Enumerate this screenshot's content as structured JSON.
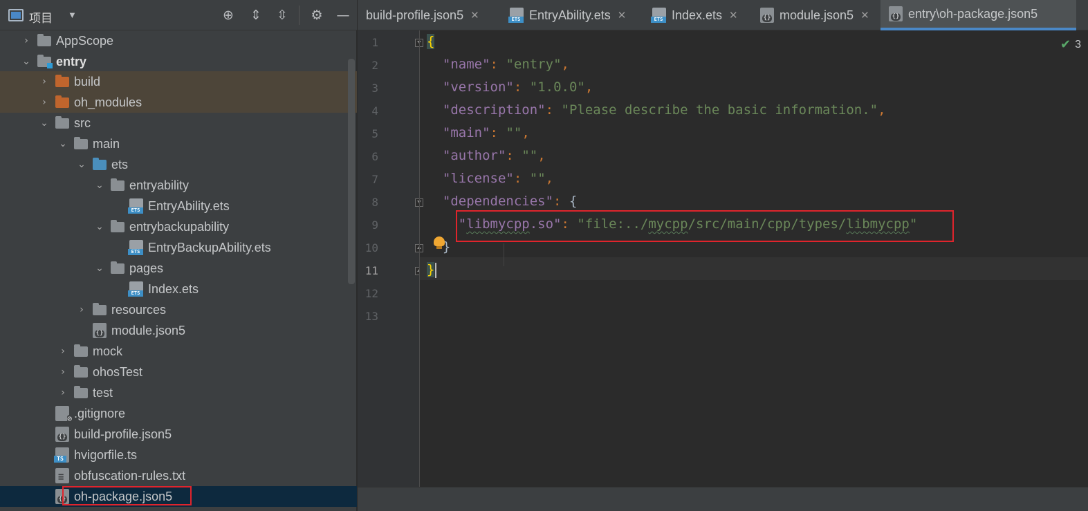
{
  "project_panel": {
    "title": "项目",
    "toolbar": {
      "dropdown_icon": "chevron-down-icon",
      "locate_icon": "crosshair-icon",
      "expand_all_icon": "expand-all-icon",
      "collapse_all_icon": "collapse-all-icon",
      "settings_icon": "gear-icon",
      "hide_icon": "minimize-icon"
    },
    "tree": [
      {
        "label": "AppScope",
        "type": "folder",
        "expanded": false
      },
      {
        "label": "entry",
        "type": "module-folder",
        "expanded": true
      },
      {
        "label": "build",
        "type": "folder-orange",
        "expanded": false
      },
      {
        "label": "oh_modules",
        "type": "folder-orange",
        "expanded": false
      },
      {
        "label": "src",
        "type": "folder",
        "expanded": true
      },
      {
        "label": "main",
        "type": "folder",
        "expanded": true
      },
      {
        "label": "ets",
        "type": "folder-blue",
        "expanded": true
      },
      {
        "label": "entryability",
        "type": "folder",
        "expanded": true
      },
      {
        "label": "EntryAbility.ets",
        "type": "ets-file"
      },
      {
        "label": "entrybackupability",
        "type": "folder",
        "expanded": true
      },
      {
        "label": "EntryBackupAbility.ets",
        "type": "ets-file"
      },
      {
        "label": "pages",
        "type": "folder",
        "expanded": true
      },
      {
        "label": "Index.ets",
        "type": "ets-file"
      },
      {
        "label": "resources",
        "type": "folder",
        "expanded": false
      },
      {
        "label": "module.json5",
        "type": "json-file"
      },
      {
        "label": "mock",
        "type": "folder",
        "expanded": false
      },
      {
        "label": "ohosTest",
        "type": "folder",
        "expanded": false
      },
      {
        "label": "test",
        "type": "folder",
        "expanded": false
      },
      {
        "label": ".gitignore",
        "type": "git-file"
      },
      {
        "label": "build-profile.json5",
        "type": "json-file"
      },
      {
        "label": "hvigorfile.ts",
        "type": "ts-file"
      },
      {
        "label": "obfuscation-rules.txt",
        "type": "txt-file"
      },
      {
        "label": "oh-package.json5",
        "type": "json-file",
        "selected": true
      }
    ]
  },
  "editor": {
    "tabs": [
      {
        "label": "build-profile.json5",
        "icon": "none",
        "active": false
      },
      {
        "label": "EntryAbility.ets",
        "icon": "ets-file-icon",
        "active": false
      },
      {
        "label": "Index.ets",
        "icon": "ets-file-icon",
        "active": false
      },
      {
        "label": "module.json5",
        "icon": "json-file-icon",
        "active": false
      },
      {
        "label": "entry\\oh-package.json5",
        "icon": "json-file-icon",
        "active": true
      }
    ],
    "close_glyph": "✕",
    "inspection_count": "3",
    "line_numbers": [
      "1",
      "2",
      "3",
      "4",
      "5",
      "6",
      "7",
      "8",
      "9",
      "10",
      "11",
      "12",
      "13"
    ],
    "code": {
      "l1_open": "{",
      "l2_key": "\"name\"",
      "l2_val": "\"entry\"",
      "l3_key": "\"version\"",
      "l3_val": "\"1.0.0\"",
      "l4_key": "\"description\"",
      "l4_val": "\"Please describe the basic information.\"",
      "l5_key": "\"main\"",
      "l5_val": "\"\"",
      "l6_key": "\"author\"",
      "l6_val": "\"\"",
      "l7_key": "\"license\"",
      "l7_val": "\"\"",
      "l8_key": "\"dependencies\"",
      "l8_open": "{",
      "l9_q": "\"",
      "l9_key_a": "libmycpp",
      "l9_key_b": ".so\"",
      "l9_val_a": "\"file:../",
      "l9_val_b": "mycpp",
      "l9_val_c": "/src/main/cpp/types/",
      "l9_val_d": "libmycpp",
      "l9_val_e": "\"",
      "l10_close": "}",
      "l11_close": "}"
    }
  },
  "colors": {
    "highlight_box": "#e0242c",
    "key": "#9876aa",
    "string": "#6a8759",
    "punctuation": "#cc7832",
    "accent": "#4a88c7"
  }
}
